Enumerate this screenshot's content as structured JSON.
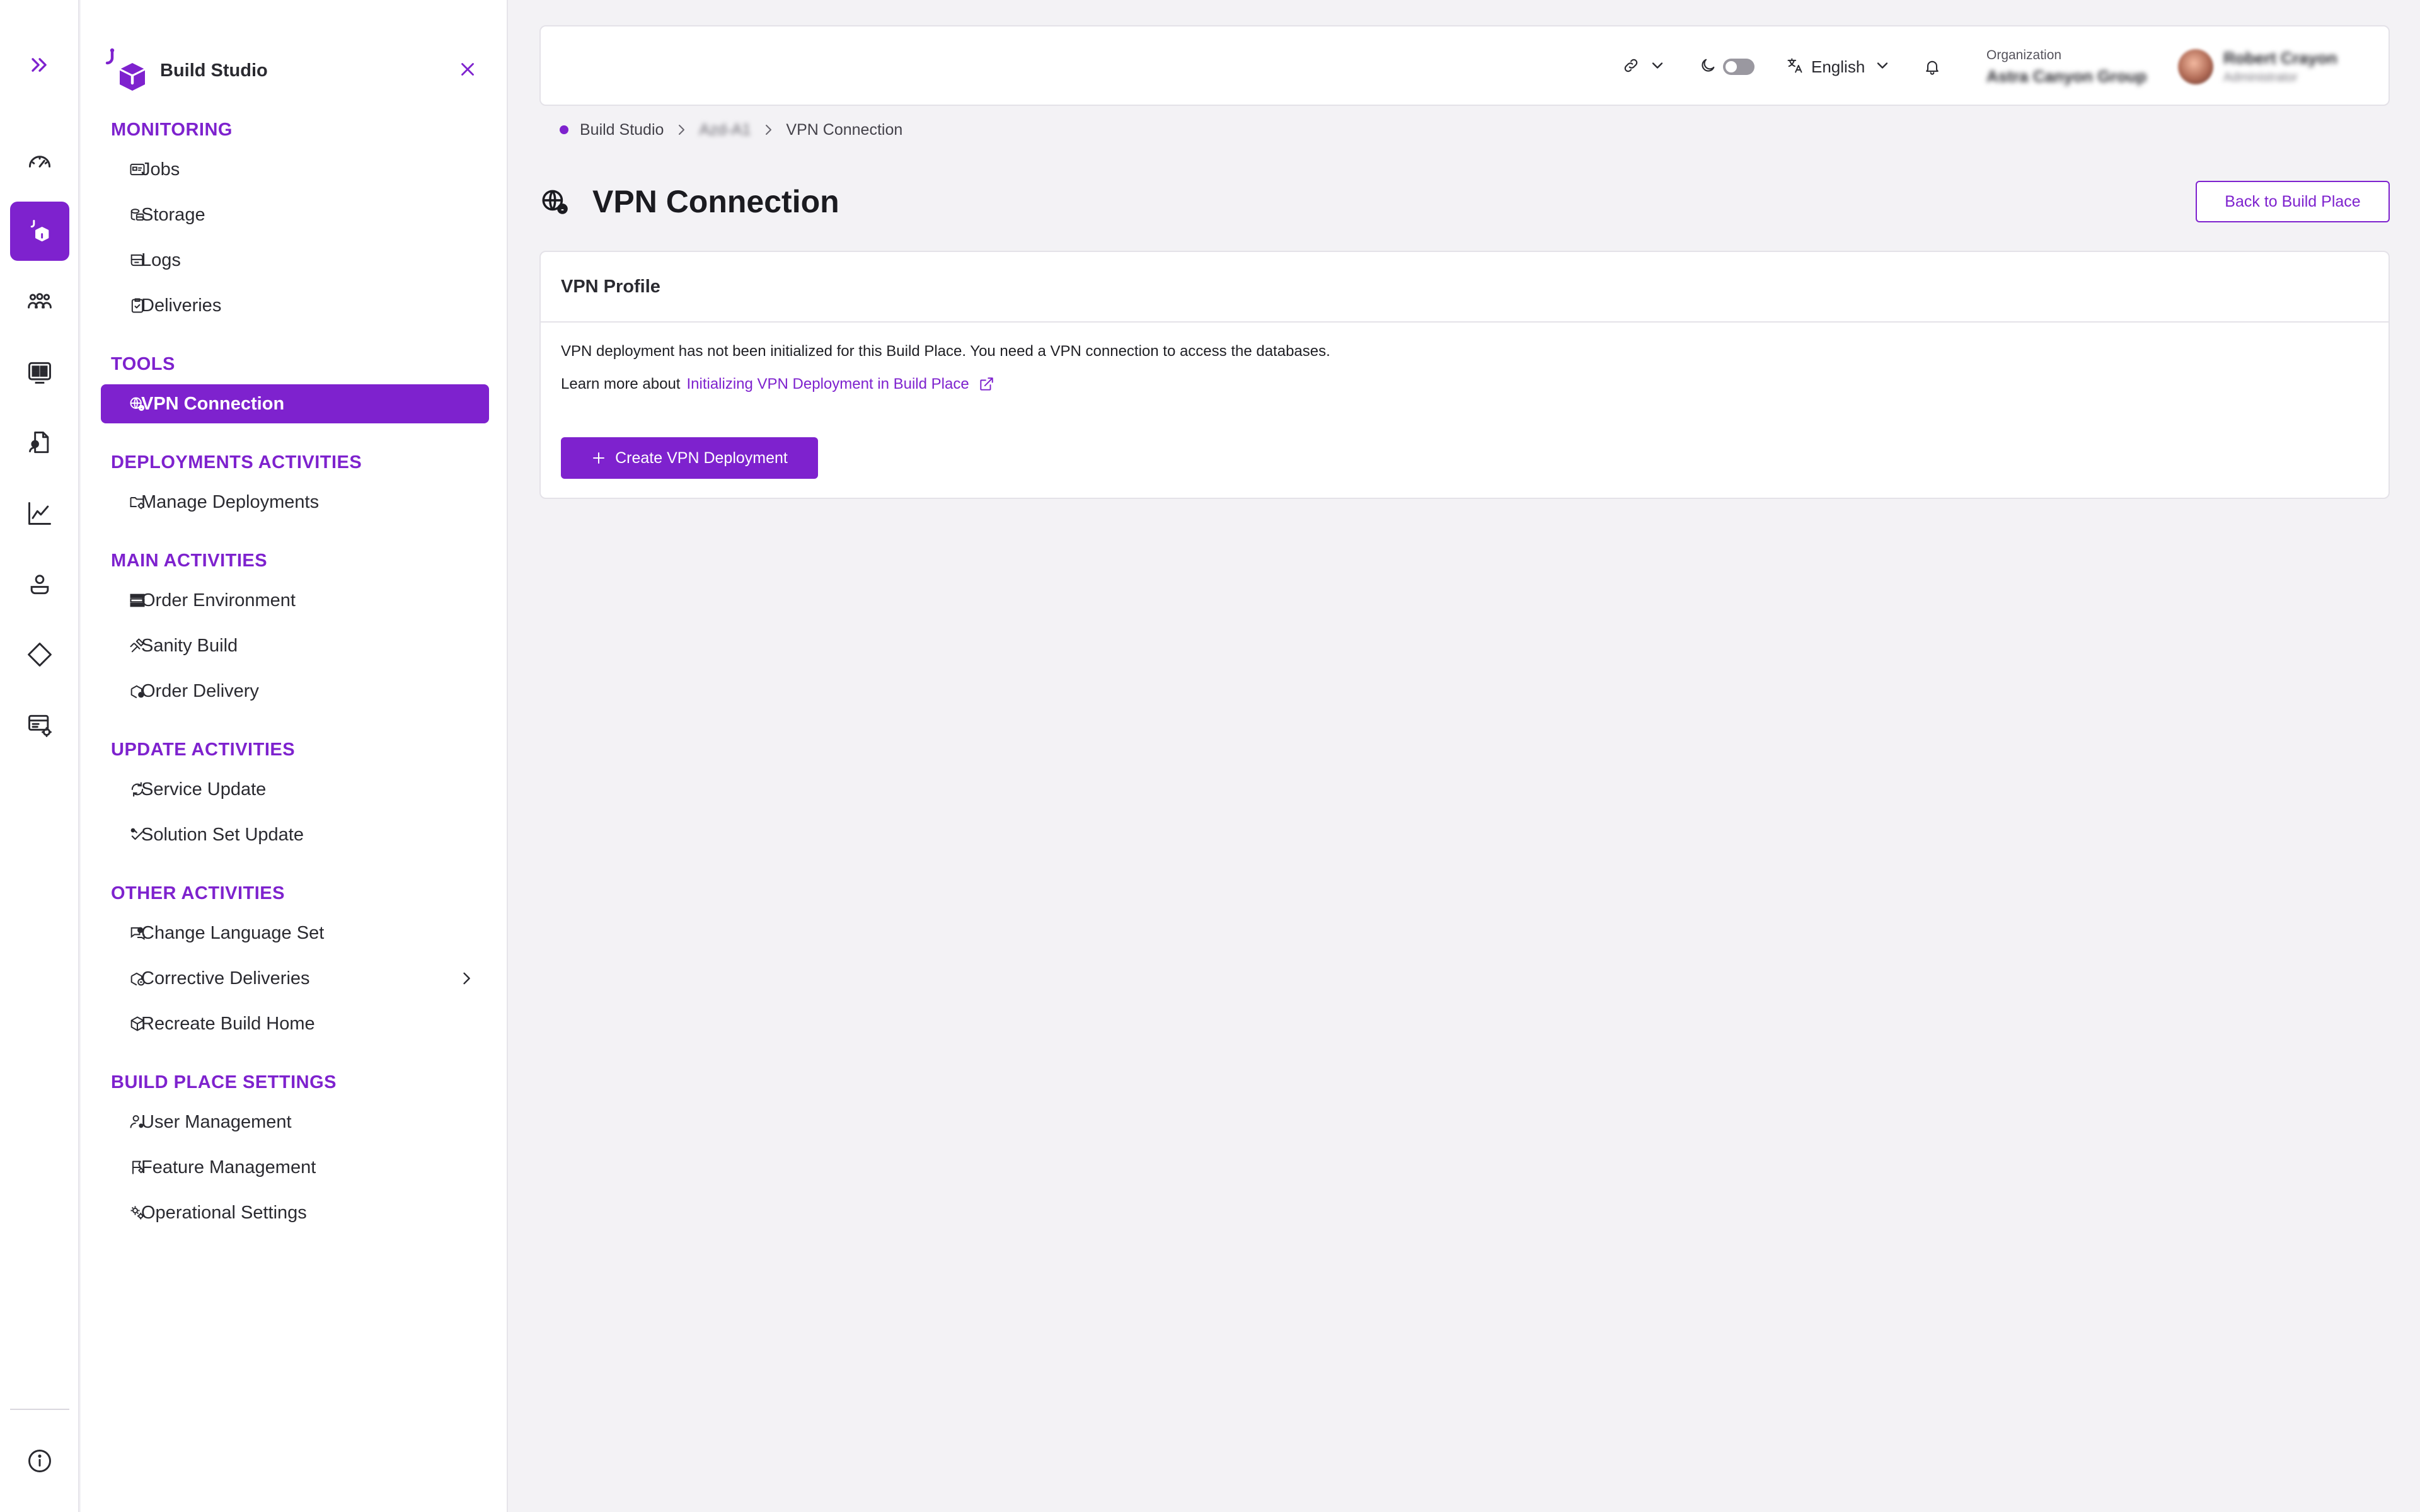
{
  "app": {
    "name": "Build Studio"
  },
  "sidebar": {
    "sections": [
      {
        "title": "MONITORING",
        "items": [
          "Jobs",
          "Storage",
          "Logs",
          "Deliveries"
        ]
      },
      {
        "title": "TOOLS",
        "items": [
          "VPN Connection"
        ]
      },
      {
        "title": "DEPLOYMENTS ACTIVITIES",
        "items": [
          "Manage Deployments"
        ]
      },
      {
        "title": "MAIN ACTIVITIES",
        "items": [
          "Order Environment",
          "Sanity Build",
          "Order Delivery"
        ]
      },
      {
        "title": "UPDATE ACTIVITIES",
        "items": [
          "Service Update",
          "Solution Set Update"
        ]
      },
      {
        "title": "OTHER ACTIVITIES",
        "items": [
          "Change Language Set",
          "Corrective Deliveries",
          "Recreate Build Home"
        ]
      },
      {
        "title": "BUILD PLACE SETTINGS",
        "items": [
          "User Management",
          "Feature Management",
          "Operational Settings"
        ]
      }
    ],
    "active_item": "VPN Connection"
  },
  "topbar": {
    "language": "English",
    "org_label": "Organization",
    "org_name": "Astra Canyon Group",
    "user_name": "Robert Crayon",
    "user_role": "Administrator"
  },
  "breadcrumb": {
    "root": "Build Studio",
    "middle": "Azd-A1",
    "current": "VPN Connection"
  },
  "page": {
    "title": "VPN Connection",
    "back_button": "Back to Build Place"
  },
  "card": {
    "title": "VPN Profile",
    "message": "VPN deployment has not been initialized for this Build Place. You need a VPN connection to access the databases.",
    "learn_prefix": "Learn more about",
    "learn_link": "Initializing VPN Deployment in Build Place",
    "create_button": "Create VPN Deployment"
  },
  "colors": {
    "accent": "#7e22ce",
    "background": "#f3f2f5"
  }
}
